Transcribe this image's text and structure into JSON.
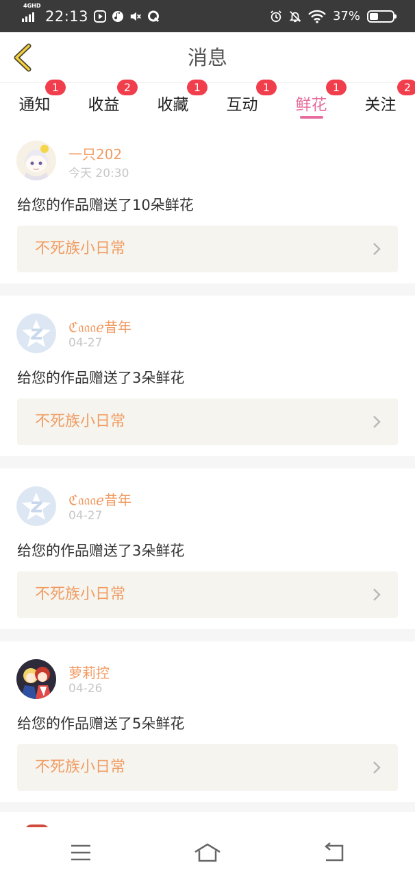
{
  "status_bar": {
    "network": "4GHD",
    "time": "22:13",
    "battery_percent": "37%",
    "battery_level": 0.37,
    "icons": [
      "signal-icon",
      "video-notification-icon",
      "music-notification-icon",
      "muted-speaker-icon",
      "q-app-icon",
      "alarm-icon",
      "bell-off-icon",
      "wifi-icon",
      "battery-icon"
    ]
  },
  "header": {
    "title": "消息",
    "back_icon": "back-chevron-icon"
  },
  "tabs": [
    {
      "label": "通知",
      "badge": "1",
      "active": false
    },
    {
      "label": "收益",
      "badge": "2",
      "active": false
    },
    {
      "label": "收藏",
      "badge": "1",
      "active": false
    },
    {
      "label": "互动",
      "badge": "1",
      "active": false
    },
    {
      "label": "鲜花",
      "badge": "1",
      "active": true
    },
    {
      "label": "关注",
      "badge": "2",
      "active": false
    }
  ],
  "messages": [
    {
      "user": "一只202",
      "time": "今天 20:30",
      "text": "给您的作品赠送了10朵鲜花",
      "work": "不死族小日常",
      "avatar": "anime-girl-avatar"
    },
    {
      "user": "ℭ𝔞𝔞𝔞ℯ昔年",
      "time": "04-27",
      "text": "给您的作品赠送了3朵鲜花",
      "work": "不死族小日常",
      "avatar": "default-star-avatar"
    },
    {
      "user": "ℭ𝔞𝔞𝔞ℯ昔年",
      "time": "04-27",
      "text": "给您的作品赠送了3朵鲜花",
      "work": "不死族小日常",
      "avatar": "default-star-avatar"
    },
    {
      "user": "萝莉控",
      "time": "04-26",
      "text": "给您的作品赠送了5朵鲜花",
      "work": "不死族小日常",
      "avatar": "anime-group-avatar"
    }
  ],
  "colors": {
    "accent_pink": "#e66d9d",
    "badge_red": "#f13e4d",
    "username_orange": "#f19b62",
    "work_bg": "#f5f4ee",
    "status_bar_bg": "#3a3a3a"
  },
  "nav_bar": {
    "icons": [
      "menu-icon",
      "home-icon",
      "return-icon"
    ]
  }
}
